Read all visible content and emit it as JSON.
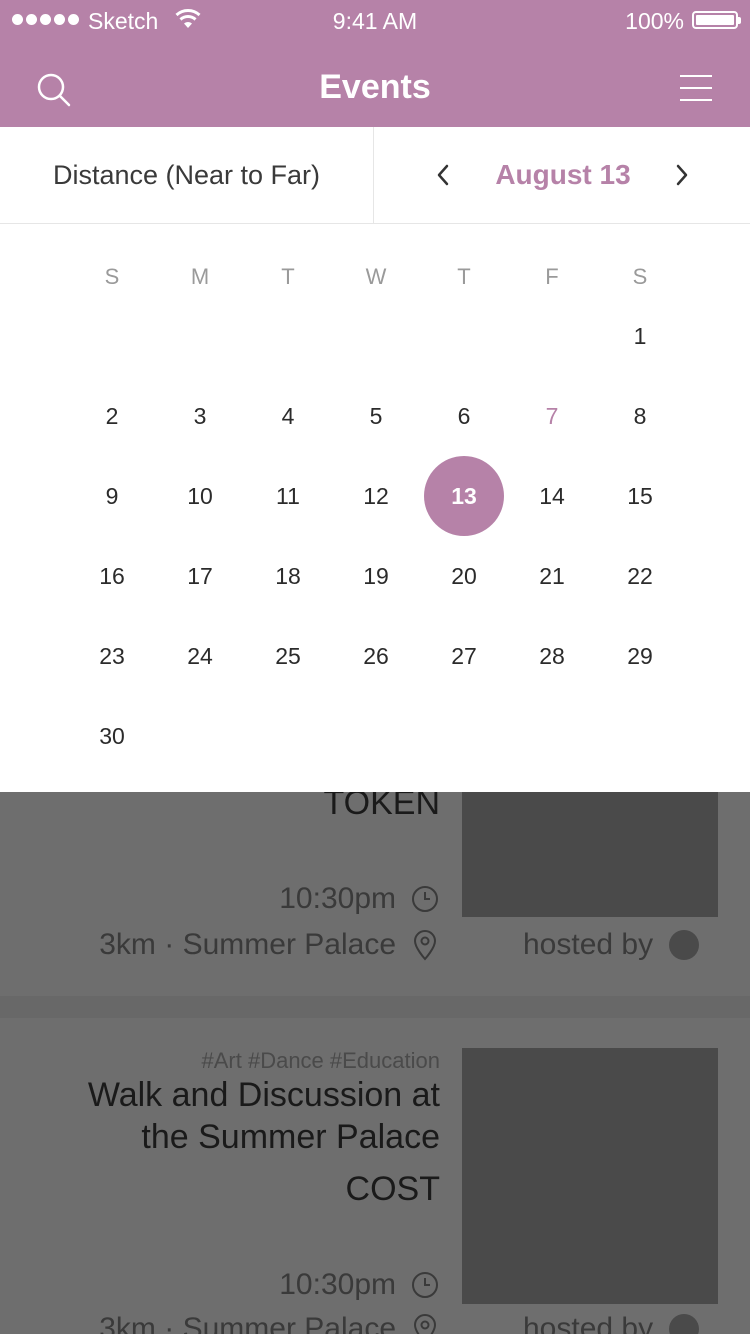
{
  "status_bar": {
    "carrier": "Sketch",
    "time": "9:41 AM",
    "battery": "100%"
  },
  "header": {
    "title": "Events",
    "search_icon": "search-icon",
    "menu_icon": "hamburger-menu-icon"
  },
  "filter": {
    "sort_label": "Distance (Near to Far)",
    "date_label": "August 13",
    "prev_icon": "chevron-left-icon",
    "next_icon": "chevron-right-icon"
  },
  "calendar": {
    "weekdays": [
      "S",
      "M",
      "T",
      "W",
      "T",
      "F",
      "S"
    ],
    "weeks": [
      [
        "",
        "",
        "",
        "",
        "",
        "",
        "1"
      ],
      [
        "2",
        "3",
        "4",
        "5",
        "6",
        "7",
        "8"
      ],
      [
        "9",
        "10",
        "11",
        "12",
        "13",
        "14",
        "15"
      ],
      [
        "16",
        "17",
        "18",
        "19",
        "20",
        "21",
        "22"
      ],
      [
        "23",
        "24",
        "25",
        "26",
        "27",
        "28",
        "29"
      ],
      [
        "30",
        "",
        "",
        "",
        "",
        "",
        ""
      ]
    ],
    "selected_day": "13",
    "highlighted_day": "7"
  },
  "events": [
    {
      "title_tail": "TOKEN",
      "time": "10:30pm",
      "location": "3km · Summer Palace",
      "host": "hosted by"
    },
    {
      "tags": "#Art #Dance #Education",
      "title_line1": "Walk and Discussion at",
      "title_line2": "the Summer Palace",
      "cost": "COST",
      "time": "10:30pm",
      "location": "3km · Summer Palace",
      "host": "hosted by"
    }
  ],
  "colors": {
    "accent": "#b682a8",
    "overlay": "#686868"
  }
}
